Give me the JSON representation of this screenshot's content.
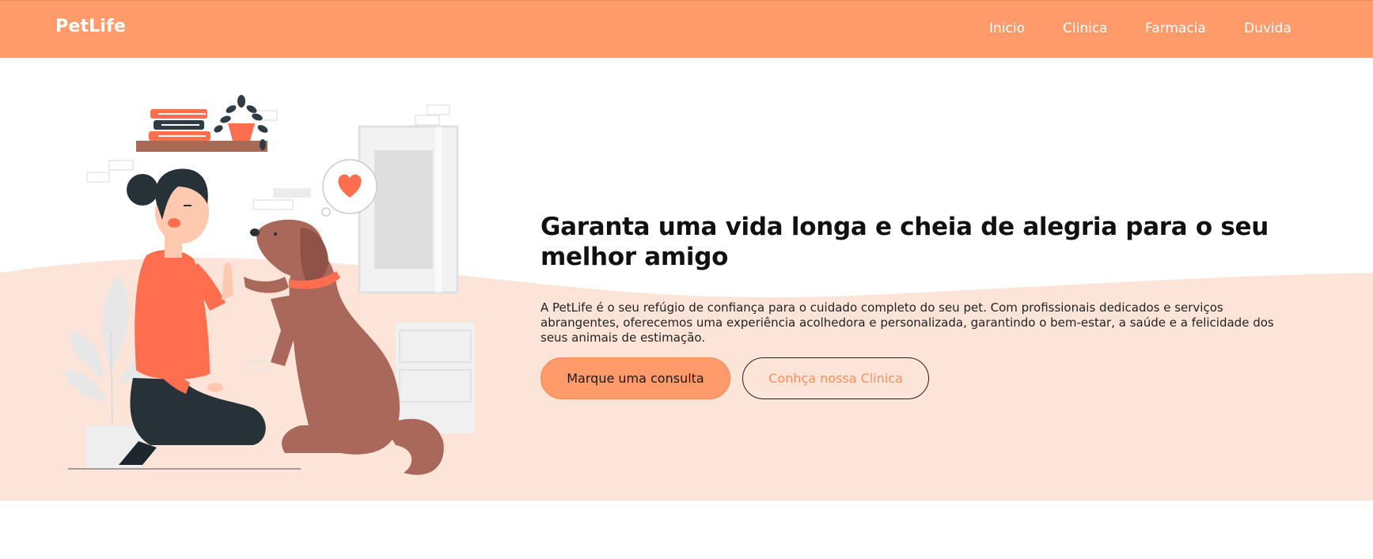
{
  "colors": {
    "accent": "#ff9b6a",
    "hero_bg": "#fde4d9",
    "text_dark": "#111111"
  },
  "header": {
    "logo": "PetLife",
    "nav": [
      {
        "label": "Inicio"
      },
      {
        "label": "Clinica"
      },
      {
        "label": "Farmacia"
      },
      {
        "label": "Duvida"
      }
    ]
  },
  "hero": {
    "headline": "Garanta uma vida longa e cheia de alegria para o seu melhor amigo",
    "description": "A PetLife é o seu refúgio de confiança para o cuidado completo do seu pet. Com profissionais dedicados e serviços abrangentes, oferecemos uma experiência acolhedora e personalizada, garantindo o bem-estar, a saúde e a felicidade dos seus animais de estimação.",
    "primary_button": "Marque uma consulta",
    "secondary_button": "Conhça nossa Clinica",
    "illustration_icon": "woman-high-five-dog-illustration"
  }
}
